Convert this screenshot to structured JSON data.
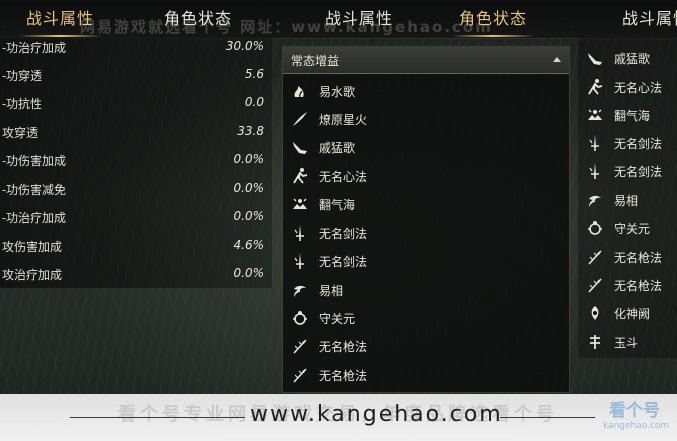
{
  "tabs": [
    {
      "label": "战斗属性",
      "active": true
    },
    {
      "label": "角色状态",
      "active": false
    },
    {
      "label": "战斗属性",
      "active": false
    },
    {
      "label": "角色状态",
      "active": true
    },
    {
      "label": "战斗属性",
      "active": false
    }
  ],
  "watermark": {
    "top_text": "网易游戏就选看个号  网址：www.kangehao.com",
    "footer_url": "www.kangehao.com",
    "footer_ghost": "看个号专业网易游戏交易，年度品牌选看个号",
    "logo_text": "看个号",
    "logo_sub": "kangehao.com"
  },
  "attributes": [
    {
      "name": "-功治疗加成",
      "value": "30.0%"
    },
    {
      "name": "-功穿透",
      "value": "5.6"
    },
    {
      "name": "-功抗性",
      "value": "0.0"
    },
    {
      "name": "攻穿透",
      "value": "33.8"
    },
    {
      "name": "-功伤害加成",
      "value": "0.0%"
    },
    {
      "name": "-功伤害减免",
      "value": "0.0%"
    },
    {
      "name": "-功治疗加成",
      "value": "0.0%"
    },
    {
      "name": "攻伤害加成",
      "value": "4.6%"
    },
    {
      "name": "攻治疗加成",
      "value": "0.0%"
    }
  ],
  "dropdown": {
    "header": "常态增益",
    "items": [
      {
        "label": "易水歌",
        "icon": "flame-swirl-icon"
      },
      {
        "label": "燎原星火",
        "icon": "slash-stroke-icon"
      },
      {
        "label": "戚猛歌",
        "icon": "fist-strike-icon"
      },
      {
        "label": "无名心法",
        "icon": "pose-figure-icon"
      },
      {
        "label": "翻气海",
        "icon": "qi-burst-icon"
      },
      {
        "label": "无名剑法",
        "icon": "sword-icon"
      },
      {
        "label": "无名剑法",
        "icon": "sword-icon"
      },
      {
        "label": "易相",
        "icon": "swirl-mark-icon"
      },
      {
        "label": "守关元",
        "icon": "shield-burst-icon"
      },
      {
        "label": "无名枪法",
        "icon": "spear-icon"
      },
      {
        "label": "无名枪法",
        "icon": "spear-icon"
      }
    ]
  },
  "right_list": [
    {
      "label": "戚猛歌",
      "icon": "fist-strike-icon"
    },
    {
      "label": "无名心法",
      "icon": "pose-figure-icon"
    },
    {
      "label": "翻气海",
      "icon": "qi-burst-icon"
    },
    {
      "label": "无名剑法",
      "icon": "sword-icon"
    },
    {
      "label": "无名剑法",
      "icon": "sword-icon"
    },
    {
      "label": "易相",
      "icon": "swirl-mark-icon"
    },
    {
      "label": "守关元",
      "icon": "shield-burst-icon"
    },
    {
      "label": "无名枪法",
      "icon": "spear-icon"
    },
    {
      "label": "无名枪法",
      "icon": "spear-icon"
    },
    {
      "label": "化神阙",
      "icon": "spirit-icon"
    },
    {
      "label": "玉斗",
      "icon": "dipper-icon"
    }
  ],
  "colors": {
    "accent_gold": "#e7c27a",
    "text_light": "#ebe6da",
    "panel_dark": "#0a0c0b"
  }
}
